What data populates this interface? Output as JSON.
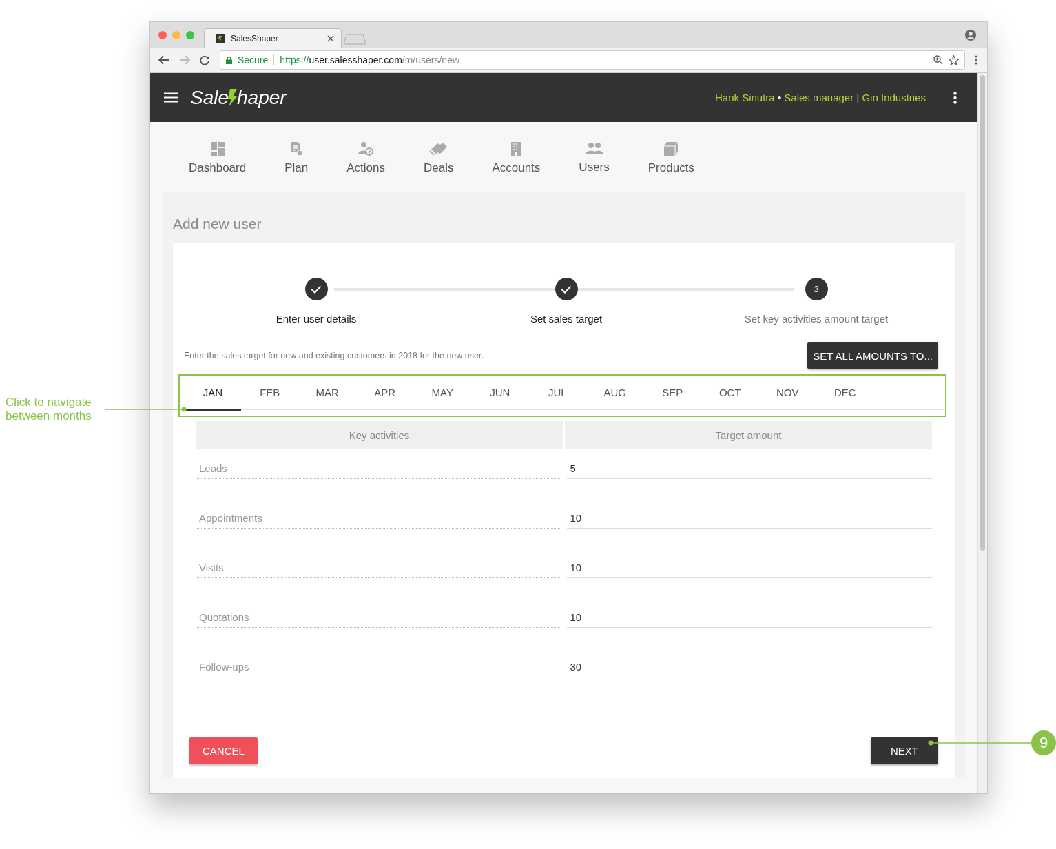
{
  "browser": {
    "tab_title": "SalesShaper",
    "secure_label": "Secure",
    "url_scheme": "https://",
    "url_host": "user.salesshaper.com",
    "url_path": "/m/users/new"
  },
  "header": {
    "logo_left": "Sale",
    "logo_right": "haper",
    "user_name": "Hank Sinutra",
    "dot": "•",
    "role": "Sales manager",
    "bar": "|",
    "company": "Gin Industries"
  },
  "nav": [
    {
      "label": "Dashboard"
    },
    {
      "label": "Plan"
    },
    {
      "label": "Actions"
    },
    {
      "label": "Deals"
    },
    {
      "label": "Accounts"
    },
    {
      "label": "Users"
    },
    {
      "label": "Products"
    }
  ],
  "page_title": "Add new user",
  "steps": [
    {
      "label": "Enter user details",
      "done": true
    },
    {
      "label": "Set sales target",
      "done": true
    },
    {
      "label": "Set key activities amount target",
      "number": "3",
      "done": false
    }
  ],
  "intro": "Enter the sales target for new and existing customers in 2018 for the new user.",
  "set_all_button": "SET ALL AMOUNTS TO...",
  "months": [
    {
      "label": "JAN",
      "selected": true
    },
    {
      "label": "FEB",
      "selected": false
    },
    {
      "label": "MAR",
      "selected": false
    },
    {
      "label": "APR",
      "selected": false
    },
    {
      "label": "MAY",
      "selected": false
    },
    {
      "label": "JUN",
      "selected": false
    },
    {
      "label": "JUL",
      "selected": false
    },
    {
      "label": "AUG",
      "selected": false
    },
    {
      "label": "SEP",
      "selected": false
    },
    {
      "label": "OCT",
      "selected": false
    },
    {
      "label": "NOV",
      "selected": false
    },
    {
      "label": "DEC",
      "selected": false
    }
  ],
  "table": {
    "columns": [
      "Key activities",
      "Target amount"
    ],
    "rows": [
      {
        "activity": "Leads",
        "target": "5"
      },
      {
        "activity": "Appointments",
        "target": "10"
      },
      {
        "activity": "Visits",
        "target": "10"
      },
      {
        "activity": "Quotations",
        "target": "10"
      },
      {
        "activity": "Follow-ups",
        "target": "30"
      }
    ]
  },
  "cancel_button": "CANCEL",
  "next_button": "NEXT",
  "annotations": {
    "months_note": "Click to navigate between months",
    "step_badge": "9"
  }
}
